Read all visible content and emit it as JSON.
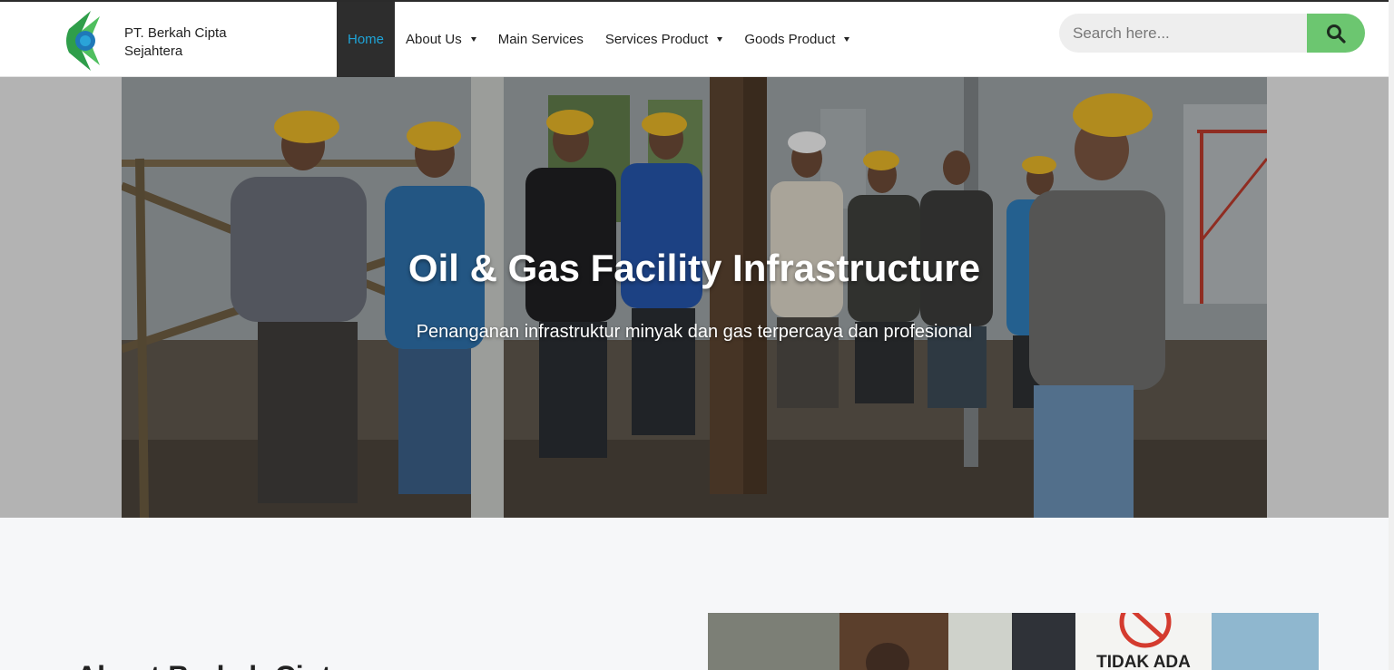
{
  "brand": {
    "name": "PT. Berkah Cipta Sejahtera",
    "logo_icon": "company-logo"
  },
  "nav": {
    "items": [
      {
        "label": "Home",
        "dropdown": false,
        "active": true
      },
      {
        "label": "About Us",
        "dropdown": true,
        "active": false
      },
      {
        "label": "Main Services",
        "dropdown": false,
        "active": false
      },
      {
        "label": "Services Product",
        "dropdown": true,
        "active": false
      },
      {
        "label": "Goods Product",
        "dropdown": true,
        "active": false
      }
    ]
  },
  "search": {
    "placeholder": "Search here...",
    "value": "",
    "icon": "search-icon"
  },
  "hero": {
    "title": "Oil & Gas Facility Infrastructure",
    "subtitle": "Penanganan infrastruktur minyak dan gas terpercaya dan profesional"
  },
  "about": {
    "heading": "About Berkah Cipta",
    "photo_sign_text": "TIDAK ADA"
  },
  "colors": {
    "accent": "#1fa3d6",
    "search_button": "#6cc670",
    "nav_active_bg": "#2d2d2d"
  }
}
